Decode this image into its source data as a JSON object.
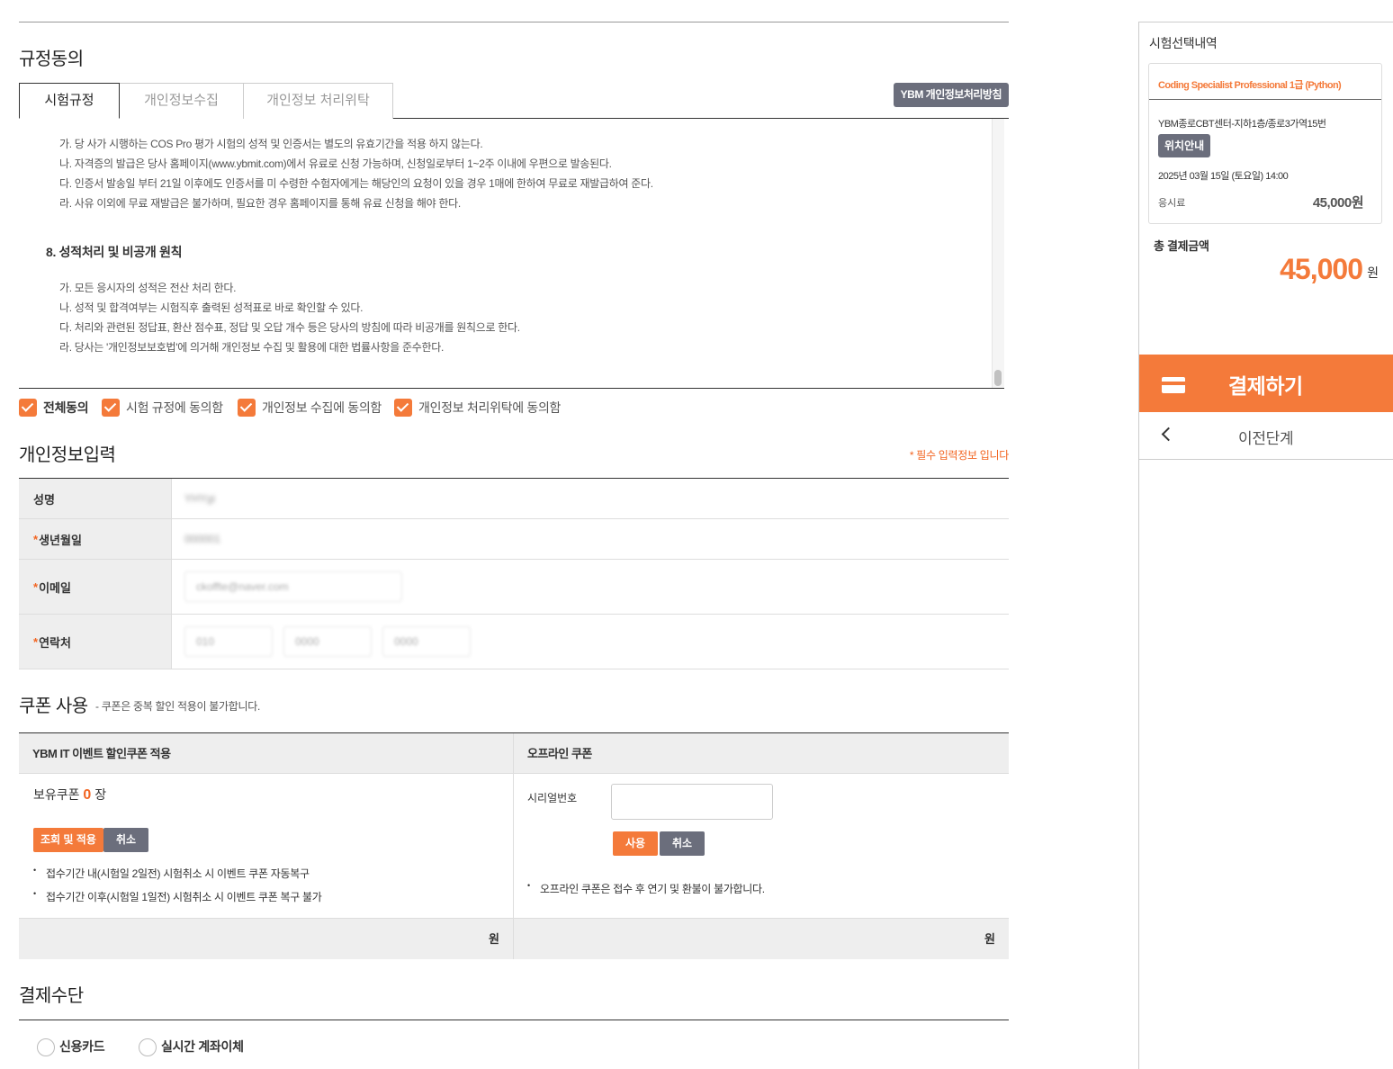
{
  "rules": {
    "title": "규정동의",
    "tabs": [
      "시험규정",
      "개인정보수집",
      "개인정보 처리위탁"
    ],
    "policy_button": "YBM 개인정보처리방침",
    "lines_a": [
      "가. 당 사가 시행하는 COS Pro 평가 시험의 성적 및 인증서는 별도의 유효기간을 적용 하지 않는다.",
      "나. 자격증의 발급은 당사 홈페이지(www.ybmit.com)에서 유료로 신청 가능하며, 신청일로부터 1~2주 이내에 우편으로 발송된다.",
      "다. 인증서 발송일 부터 21일 이후에도 인증서를 미 수령한 수험자에게는 해당인의 요청이 있을 경우 1매에 한하여 무료로 재발급하여 준다.",
      "라. 사유 이외에 무료 재발급은 불가하며, 필요한 경우 홈페이지를 통해 유료 신청을 해야 한다."
    ],
    "heading_8": "8. 성적처리 및 비공개 원칙",
    "lines_b": [
      "가. 모든 응시자의 성적은 전산 처리 한다.",
      "나. 성적 및 합격여부는 시험직후 출력된 성적표로 바로 확인할 수 있다.",
      "다. 처리와 관련된 정답표, 환산 점수표, 정답 및 오답 개수 등은 당사의 방침에 따라 비공개를 원칙으로 한다.",
      "라. 당사는 '개인정보보호법'에 의거해 개인정보 수집 및 활용에 대한 법률사항을 준수한다."
    ],
    "agree": {
      "all": "전체동의",
      "rules": "시험 규정에 동의함",
      "collect": "개인정보 수집에 동의함",
      "entrust": "개인정보 처리위탁에 동의함"
    }
  },
  "personal": {
    "title": "개인정보입력",
    "required_note": "* 필수 입력정보 입니다",
    "star": "*",
    "name_label": "성명",
    "name_value": "YHYgi",
    "birth_label": "생년월일",
    "birth_value": "000001",
    "email_label": "이메일",
    "email_value": "ckoffte@naver.com",
    "phone_label": "연락처",
    "phone_values": [
      "010",
      "0000",
      "0000"
    ]
  },
  "coupon": {
    "title": "쿠폰 사용",
    "note": "- 쿠폰은 중복 할인 적용이 불가합니다.",
    "event_head": "YBM IT 이벤트 할인쿠폰 적용",
    "offline_head": "오프라인 쿠폰",
    "owned_label": "보유쿠폰",
    "owned_count": "0",
    "owned_unit": "장",
    "lookup_button": "조회 및 적용",
    "cancel_button": "취소",
    "event_notes": [
      "접수기간 내(시험일 2일전) 시험취소 시 이벤트 쿠폰 자동복구",
      "접수기간 이후(시험일 1일전) 시험취소 시 이벤트 쿠폰 복구 불가"
    ],
    "serial_label": "시리얼번호",
    "use_button": "사용",
    "offline_cancel_button": "취소",
    "offline_note": "오프라인 쿠폰은 접수 후 연기 및 환불이 불가합니다.",
    "won_left": "원",
    "won_right": "원"
  },
  "payment": {
    "title": "결제수단",
    "methods": [
      "신용카드",
      "실시간 계좌이체"
    ]
  },
  "sidebar": {
    "title": "시험선택내역",
    "exam": "Coding Specialist Professional 1급 (Python)",
    "location": "YBM종로CBT센터-지하1층/종로3가역15번",
    "location_button": "위치안내",
    "datetime": "2025년 03월 15일 (토요일) 14:00",
    "fee_label": "응시료",
    "fee": "45,000원",
    "total_label": "총 결제금액",
    "total": "45,000",
    "total_unit": "원",
    "pay_button": "결제하기",
    "prev_button": "이전단계"
  },
  "colors": {
    "accent": "#f47a3a",
    "gray_button": "#6b6e7c"
  }
}
